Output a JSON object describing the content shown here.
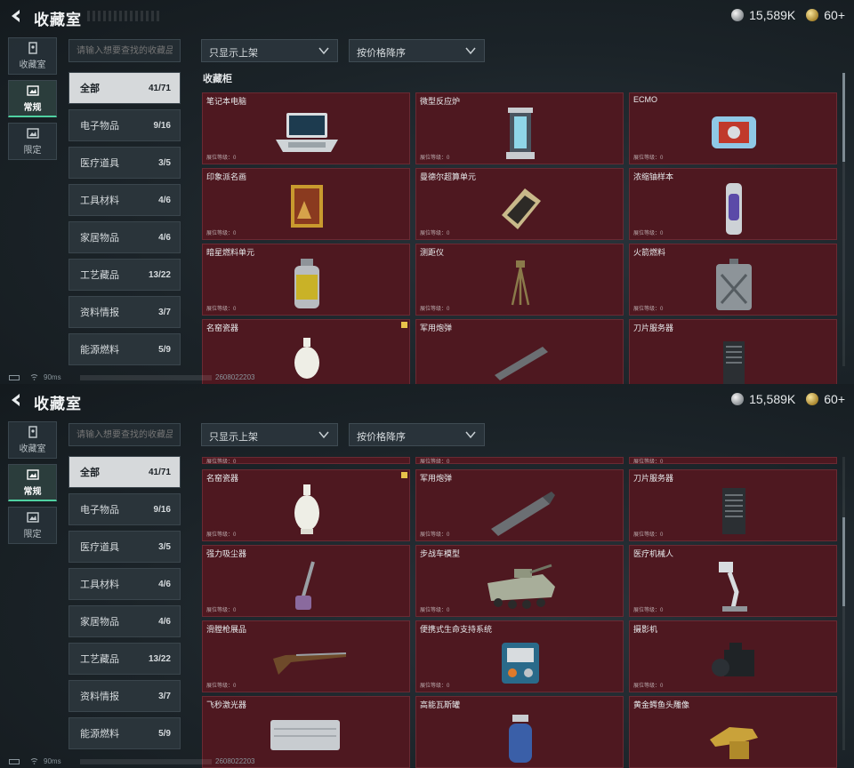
{
  "title": "收藏室",
  "currency": {
    "coins": "15,589K",
    "tickets": "60+"
  },
  "side_tabs": [
    {
      "label": "收藏室",
      "icon": "collection-room-icon",
      "active": false
    },
    {
      "label": "常规",
      "icon": "regular-icon",
      "active": true
    },
    {
      "label": "限定",
      "icon": "limited-icon",
      "active": false
    }
  ],
  "search": {
    "placeholder": "请输入想要查找的收藏品"
  },
  "filters": {
    "shelf": "只显示上架",
    "sort": "按价格降序"
  },
  "categories": [
    {
      "label": "全部",
      "count": "41/71",
      "active": true
    },
    {
      "label": "电子物品",
      "count": "9/16"
    },
    {
      "label": "医疗道具",
      "count": "3/5"
    },
    {
      "label": "工具材料",
      "count": "4/6"
    },
    {
      "label": "家居物品",
      "count": "4/6"
    },
    {
      "label": "工艺藏品",
      "count": "13/22"
    },
    {
      "label": "资料情报",
      "count": "3/7"
    },
    {
      "label": "能源燃料",
      "count": "5/9"
    }
  ],
  "section_title": "收藏柜",
  "level_label": "展位等级：0",
  "top_items": [
    {
      "name": "笔记本电脑",
      "icon": "laptop-icon"
    },
    {
      "name": "微型反应炉",
      "icon": "micro-reactor-icon"
    },
    {
      "name": "ECMO",
      "icon": "ecmo-icon"
    },
    {
      "name": "印象派名画",
      "icon": "painting-icon"
    },
    {
      "name": "曼德尔超算单元",
      "icon": "supercomputer-unit-icon"
    },
    {
      "name": "浓缩铀样本",
      "icon": "uranium-sample-icon"
    },
    {
      "name": "暗星燃料单元",
      "icon": "fuel-cell-icon"
    },
    {
      "name": "测距仪",
      "icon": "rangefinder-icon"
    },
    {
      "name": "火箭燃料",
      "icon": "rocket-fuel-icon"
    },
    {
      "name": "名窑瓷器",
      "icon": "porcelain-icon",
      "badge": true
    },
    {
      "name": "军用炮弹",
      "icon": "artillery-shell-icon"
    },
    {
      "name": "刀片服务器",
      "icon": "blade-server-icon"
    }
  ],
  "bottom_items": [
    {
      "name": "名窑瓷器",
      "icon": "porcelain-icon",
      "badge": true
    },
    {
      "name": "军用炮弹",
      "icon": "artillery-shell-icon"
    },
    {
      "name": "刀片服务器",
      "icon": "blade-server-icon"
    },
    {
      "name": "强力吸尘器",
      "icon": "vacuum-icon"
    },
    {
      "name": "步战车模型",
      "icon": "ifv-model-icon"
    },
    {
      "name": "医疗机械人",
      "icon": "medical-robot-icon"
    },
    {
      "name": "滑膛枪展品",
      "icon": "musket-icon"
    },
    {
      "name": "便携式生命支持系统",
      "icon": "life-support-icon"
    },
    {
      "name": "摄影机",
      "icon": "camera-icon"
    },
    {
      "name": "飞秒激光器",
      "icon": "laser-case-icon"
    },
    {
      "name": "高能瓦斯罐",
      "icon": "gas-canister-icon"
    },
    {
      "name": "黄金鳄鱼头雕像",
      "icon": "gold-croc-statue-icon"
    }
  ],
  "status": {
    "ping": "90ms",
    "uid": "2608022203"
  },
  "colors": {
    "card_bg": "#4e1820",
    "accent": "#4fd1a1",
    "badge": "#e8c24a"
  }
}
